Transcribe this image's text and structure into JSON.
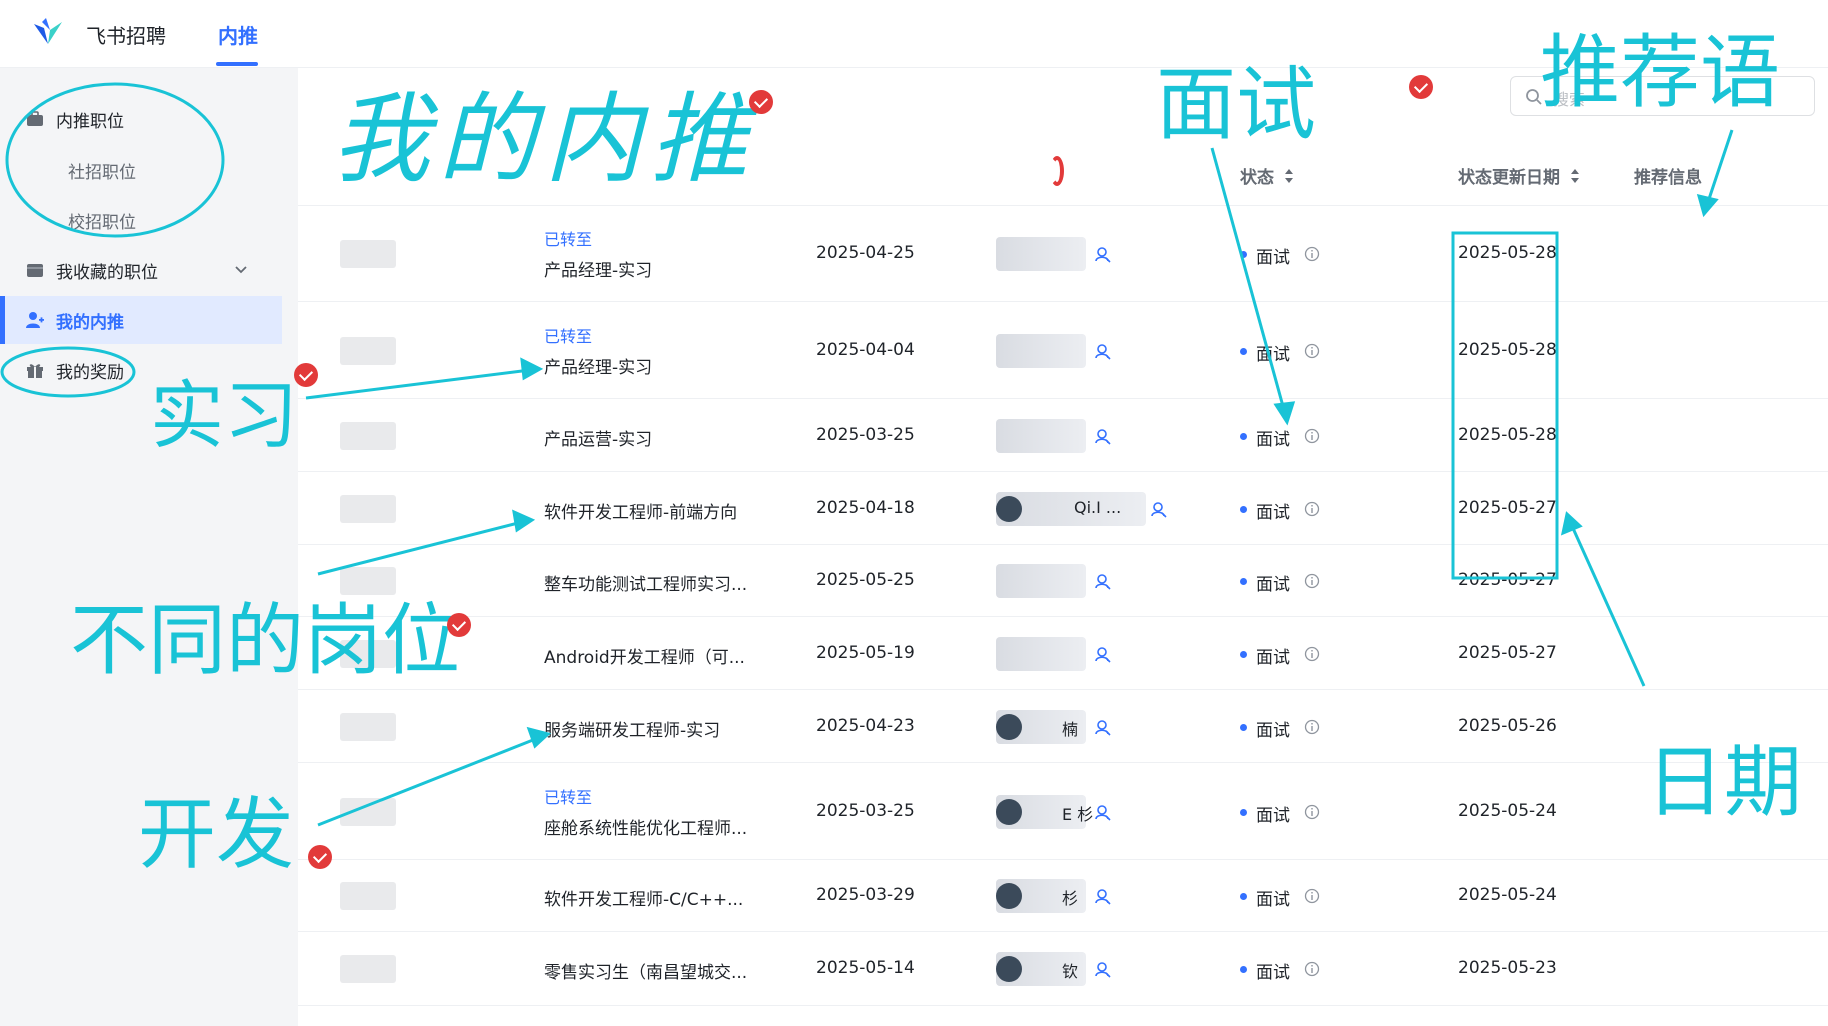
{
  "app": {
    "brand": "飞书招聘",
    "top_tab": "内推"
  },
  "sidebar": {
    "items": [
      {
        "label": "内推职位"
      },
      {
        "label": "社招职位"
      },
      {
        "label": "校招职位"
      },
      {
        "label": "我收藏的职位"
      },
      {
        "label": "我的内推"
      },
      {
        "label": "我的奖励"
      }
    ]
  },
  "search": {
    "placeholder": "搜索"
  },
  "table": {
    "headers": {
      "status": "状态",
      "updated": "状态更新日期",
      "recommend": "推荐信息"
    },
    "rows": [
      {
        "tag": "已转至",
        "position": "产品经理-实习",
        "date": "2025-04-25",
        "candidate": "",
        "status": "面试",
        "updated": "2025-05-28"
      },
      {
        "tag": "已转至",
        "position": "产品经理-实习",
        "date": "2025-04-04",
        "candidate": "",
        "status": "面试",
        "updated": "2025-05-28"
      },
      {
        "tag": "",
        "position": "产品运营-实习",
        "date": "2025-03-25",
        "candidate": "",
        "status": "面试",
        "updated": "2025-05-28"
      },
      {
        "tag": "",
        "position": "软件开发工程师-前端方向",
        "date": "2025-04-18",
        "candidate": "Qi.I ...",
        "status": "面试",
        "updated": "2025-05-27"
      },
      {
        "tag": "",
        "position": "整车功能测试工程师实习...",
        "date": "2025-05-25",
        "candidate": "",
        "status": "面试",
        "updated": "2025-05-27"
      },
      {
        "tag": "",
        "position": "Android开发工程师（可...",
        "date": "2025-05-19",
        "candidate": "",
        "status": "面试",
        "updated": "2025-05-27"
      },
      {
        "tag": "",
        "position": "服务端研发工程师-实习",
        "date": "2025-04-23",
        "candidate": "楠",
        "status": "面试",
        "updated": "2025-05-26"
      },
      {
        "tag": "已转至",
        "position": "座舱系统性能优化工程师...",
        "date": "2025-03-25",
        "candidate": "E 杉",
        "status": "面试",
        "updated": "2025-05-24"
      },
      {
        "tag": "",
        "position": "软件开发工程师-C/C++...",
        "date": "2025-03-29",
        "candidate": "杉",
        "status": "面试",
        "updated": "2025-05-24"
      },
      {
        "tag": "",
        "position": "零售实习生（南昌望城交...",
        "date": "2025-05-14",
        "candidate": "钦",
        "status": "面试",
        "updated": "2025-05-23"
      }
    ]
  },
  "annotations": {
    "my_referral": "我的内推",
    "interview": "面试",
    "recommend": "推荐语",
    "internship": "实习",
    "different_positions": "不同的岗位",
    "development": "开发",
    "date": "日期"
  },
  "colors": {
    "accent": "#3370ff",
    "annotation": "#19c3d6",
    "check": "#e23a3a",
    "sidebar_bg": "#f4f5f7"
  }
}
